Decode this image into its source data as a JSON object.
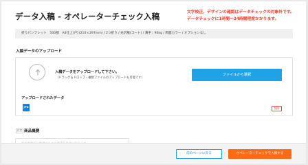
{
  "header": {
    "title": "データ入稿 - オペレーターチェック入稿",
    "notice_line1": "文字校正、デザインの確認はデータチェックの対象外です。",
    "notice_line2": "データチェックに1時間〜24時間程度かかります。"
  },
  "spec": {
    "text": "折りパンフレット　500部　A4仕上がり(210ｘ297mm) / 2つ折り / 光沢紙(コート) / 薄手：90kg / 両面カラー / オプションなし"
  },
  "upload": {
    "heading": "入稿データのアップロード",
    "main_text": "入稿データをアップロードして下さい。",
    "sub_text": "（ドラッグ＆ドロップ・複数ファイルのアップロードも可能です）",
    "button_label": "ファイルから選択",
    "uploaded_heading": "アップロードされたデータ",
    "file_icon_label": "JPG",
    "delete_label": "削除"
  },
  "overview": {
    "required_badge": "任意",
    "heading": "商品概要",
    "placeholder": "商品概要を記載頂けますと確認を早めに行えます"
  },
  "footer": {
    "back_label": "前のページに戻る",
    "next_label": "オペレーターチェックで入稿する"
  },
  "colors": {
    "accent_blue": "#1fa2e6",
    "accent_orange": "#ff6a12",
    "notice_red": "#e8412c"
  }
}
